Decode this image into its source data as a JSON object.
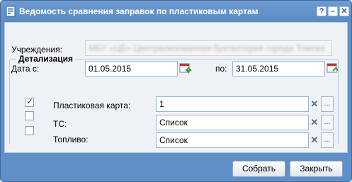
{
  "window": {
    "title": "Ведомость сравнения заправок по пластиковым картам",
    "help_label": "?",
    "minimize_label": "–",
    "close_label": "✕"
  },
  "form": {
    "institution_label": "Учреждения:",
    "institution_value": "МБУ «ЦБ» Централизованная бухгалтерия города Томска",
    "date_from_label": "Дата с:",
    "date_from_value": "01.05.2015",
    "date_to_label": "по:",
    "date_to_value": "31.05.2015"
  },
  "details": {
    "legend": "Детализация",
    "rows": [
      {
        "label": "Пластиковая карта:",
        "value": "1",
        "checked": true
      },
      {
        "label": "ТС:",
        "value": "Список",
        "checked": false
      },
      {
        "label": "Топливо:",
        "value": "Список",
        "checked": false
      }
    ],
    "more_label": "..."
  },
  "footer": {
    "save_label": "Собрать",
    "close_label": "Закрыть"
  },
  "icons": {
    "window": "report-icon",
    "calendar": "calendar-icon",
    "clear": "clear-icon"
  }
}
